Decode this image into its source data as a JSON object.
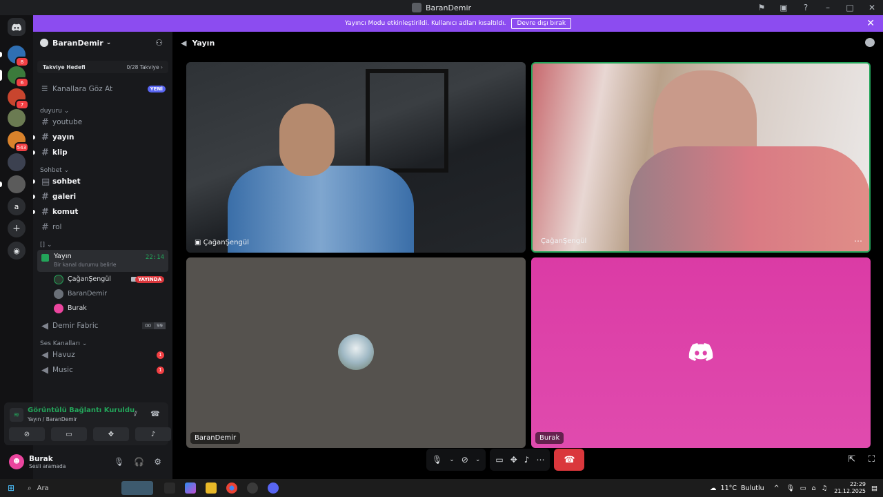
{
  "window": {
    "title": "BaranDemir"
  },
  "banner": {
    "text": "Yayıncı Modu etkinleştirildi. Kullanıcı adları kısaltıldı.",
    "button": "Devre dışı bırak"
  },
  "guilds": [
    {
      "badge": "8",
      "color": "#2f6fb3"
    },
    {
      "badge": "6",
      "color": "#3b7a3b"
    },
    {
      "badge": "7",
      "color": "#c8452e"
    },
    {
      "badge": "",
      "color": "#6b7b52"
    },
    {
      "badge": "543",
      "color": "#d9822b"
    },
    {
      "badge": "",
      "color": "#3c4150"
    },
    {
      "badge": "",
      "color": "#5b5b5b"
    },
    {
      "badge": "",
      "label": "a",
      "color": "#2b2d31"
    }
  ],
  "server": {
    "name": "BaranDemir",
    "boost": {
      "label": "Takviye Hedefi",
      "value": "0/28 Takviye"
    },
    "browse": {
      "label": "Kanallara Göz At",
      "badge": "YENİ"
    },
    "categories": [
      {
        "name": "duyuru",
        "channels": [
          "youtube",
          "yayın",
          "klip"
        ]
      },
      {
        "name": "Sohbet",
        "channels": [
          "sohbet",
          "galeri",
          "komut",
          "rol"
        ]
      }
    ],
    "voice_category": "[]",
    "active_voice": {
      "name": "Yayın",
      "status": "Bir kanal durumu belirle",
      "time": "22:14"
    },
    "members": [
      {
        "name": "ÇağanŞengül",
        "live": "YAYINDA"
      },
      {
        "name": "BaranDemir"
      },
      {
        "name": "Burak"
      }
    ],
    "demir": {
      "name": "Demir Fabric",
      "count_a": "00",
      "count_b": "99"
    },
    "ses_category": "Ses Kanalları",
    "ses_channels": [
      {
        "name": "Havuz",
        "unread": "1"
      },
      {
        "name": "Music",
        "unread": "1"
      }
    ]
  },
  "voice_status": {
    "title": "Görüntülü Bağlantı Kuruldu",
    "sub": "Yayın / BaranDemir"
  },
  "user": {
    "name": "Burak",
    "status": "Sesli aramada"
  },
  "stage": {
    "channel": "Yayın"
  },
  "tiles": [
    {
      "name": "ÇağanŞengül"
    },
    {
      "name": "ÇağanŞengül"
    },
    {
      "name": "BaranDemir"
    },
    {
      "name": "Burak"
    }
  ],
  "taskbar": {
    "search": "Ara",
    "weather": "11°C",
    "weather_desc": "Bulutlu",
    "time": "22:29",
    "date": "21.12.2025"
  }
}
